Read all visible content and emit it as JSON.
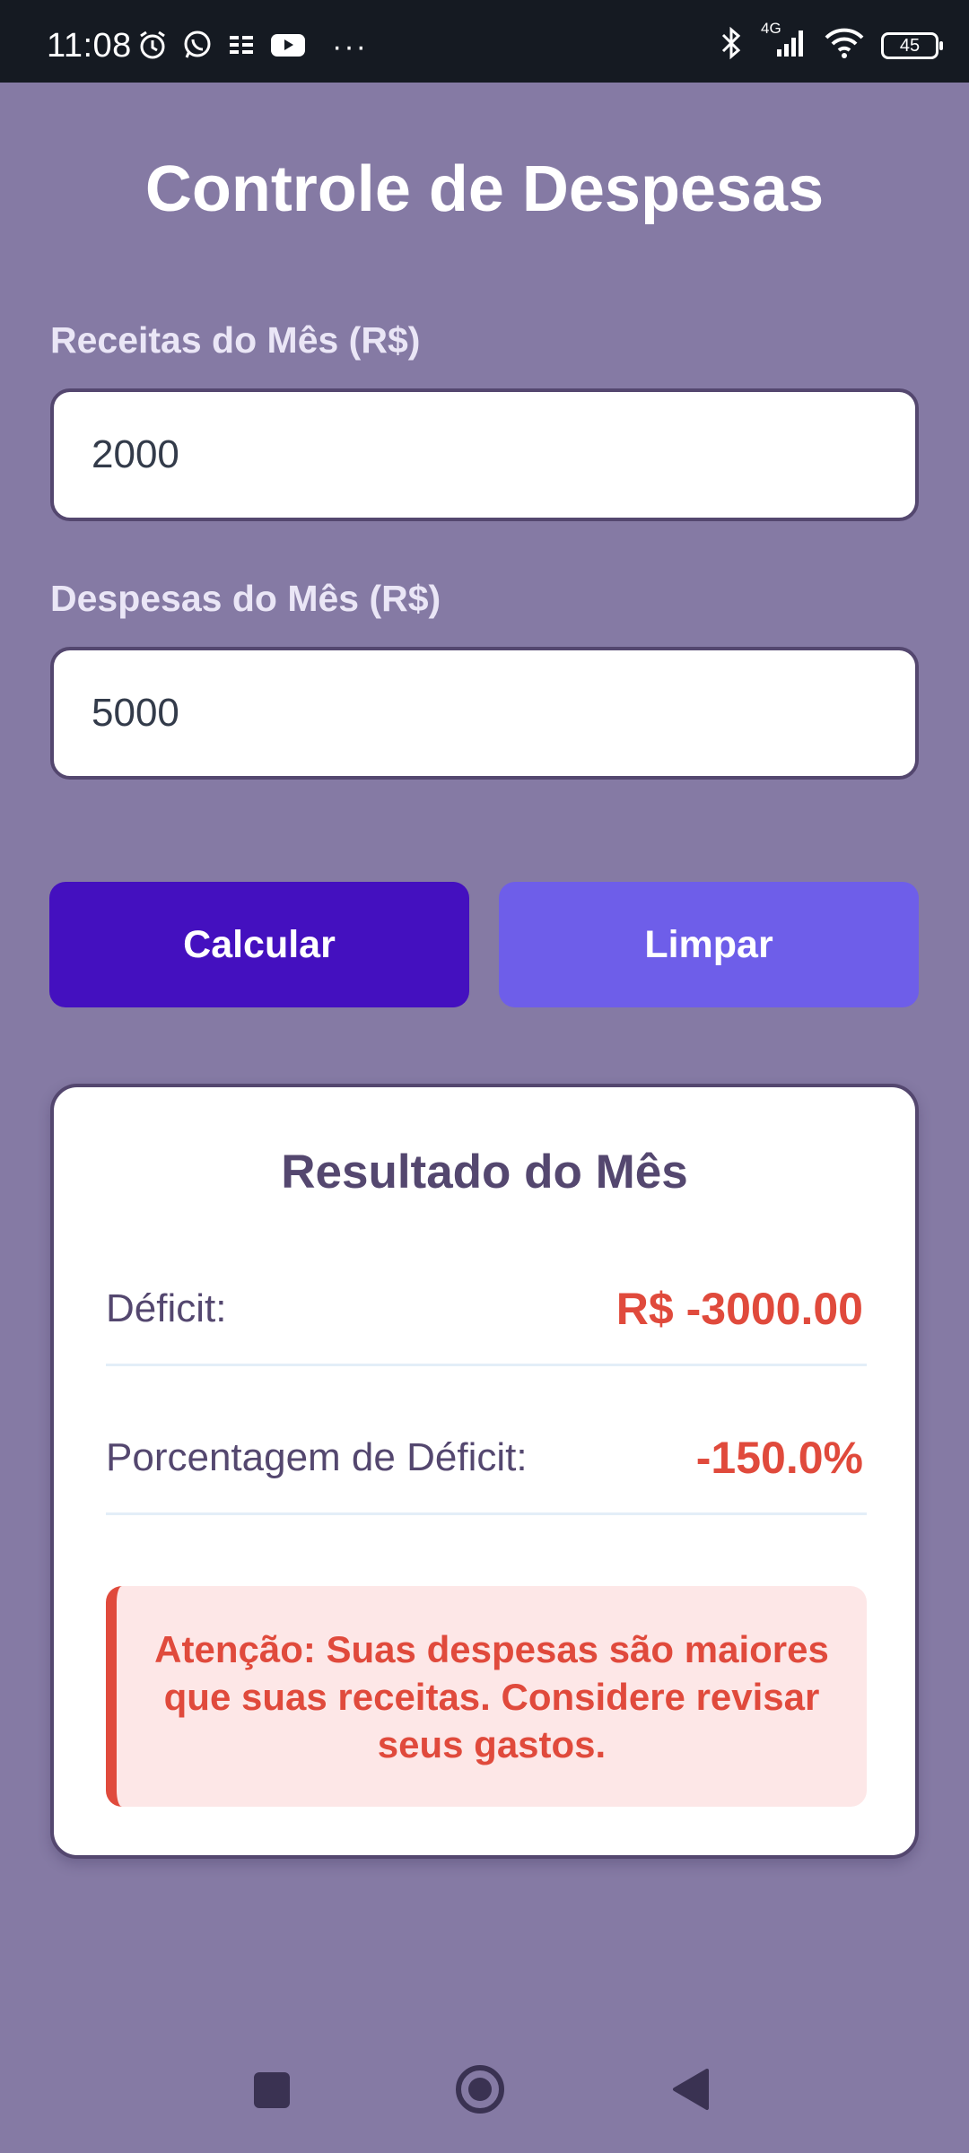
{
  "status_bar": {
    "time": "11:08",
    "network": "4G",
    "battery": "45",
    "more": "···",
    "icons": [
      "alarm-icon",
      "whatsapp-icon",
      "news-icon",
      "youtube-icon",
      "more-icon",
      "bluetooth-icon",
      "signal-icon",
      "wifi-icon",
      "battery-icon"
    ]
  },
  "page": {
    "title": "Controle de Despesas"
  },
  "form": {
    "income_label": "Receitas do Mês (R$)",
    "income_value": "2000",
    "expenses_label": "Despesas do Mês (R$)",
    "expenses_value": "5000"
  },
  "buttons": {
    "calculate": "Calcular",
    "clear": "Limpar"
  },
  "result": {
    "title": "Resultado do Mês",
    "deficit_label": "Déficit:",
    "deficit_value": "R$ -3000.00",
    "percent_label": "Porcentagem de Déficit:",
    "percent_value": "-150.0%",
    "alert_text": "Atenção: Suas despesas são maiores que suas receitas. Considere revisar seus gastos."
  },
  "colors": {
    "background": "#857aa4",
    "primary_button": "#4410bf",
    "secondary_button": "#6e5ee9",
    "deficit": "#e04a3c"
  },
  "nav_bar": {
    "icons": [
      "recents-square-icon",
      "home-circle-icon",
      "back-triangle-icon"
    ]
  }
}
